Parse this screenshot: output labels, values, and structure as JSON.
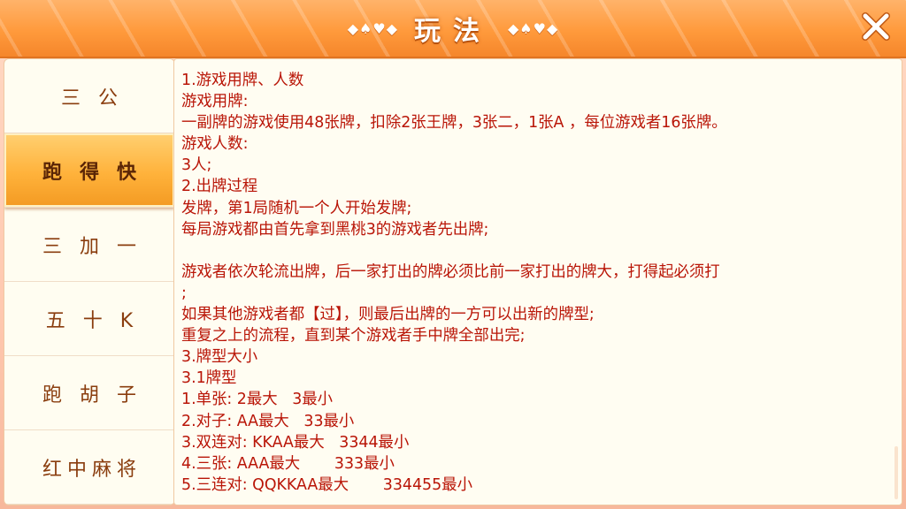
{
  "header": {
    "title": "玩法",
    "deco_left": "◆♠♥◆",
    "deco_right": "◆♠♥◆",
    "close_icon": "close-x-icon"
  },
  "sidebar": {
    "tabs": [
      {
        "label": "三公",
        "selected": false
      },
      {
        "label": "跑得快",
        "selected": true
      },
      {
        "label": "三加一",
        "selected": false
      },
      {
        "label": "五十K",
        "selected": false
      },
      {
        "label": "跑胡子",
        "selected": false
      },
      {
        "label": "红中麻将",
        "selected": false
      }
    ]
  },
  "rules": {
    "lines": [
      "1.游戏用牌、人数",
      "游戏用牌:",
      "一副牌的游戏使用48张牌，扣除2张王牌，3张二，1张A ，每位游戏者16张牌。",
      "游戏人数:",
      "3人;",
      "2.出牌过程",
      "发牌，第1局随机一个人开始发牌;",
      "每局游戏都由首先拿到黑桃3的游戏者先出牌;",
      "",
      "游戏者依次轮流出牌，后一家打出的牌必须比前一家打出的牌大，打得起必须打",
      ";",
      "如果其他游戏者都【过】，则最后出牌的一方可以出新的牌型;",
      "重复之上的流程，直到某个游戏者手中牌全部出完;",
      "3.牌型大小",
      "3.1牌型",
      "1.单张: 2最大   3最小",
      "2.对子: AA最大   33最小",
      "3.双连对: KKAA最大   3344最小",
      "4.三张: AAA最大       333最小",
      "5.三连对: QQKKAA最大       334455最小"
    ]
  },
  "colors": {
    "header_orange": "#ff9a3c",
    "selected_tab": "#ffb23b",
    "rule_text": "#b91507",
    "tab_text": "#8a3d0e"
  }
}
